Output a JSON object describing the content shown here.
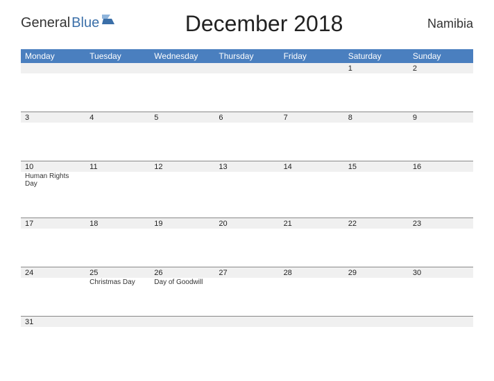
{
  "header": {
    "logo_general": "General",
    "logo_blue": "Blue",
    "title": "December 2018",
    "region": "Namibia"
  },
  "days": [
    "Monday",
    "Tuesday",
    "Wednesday",
    "Thursday",
    "Friday",
    "Saturday",
    "Sunday"
  ],
  "weeks": [
    {
      "cells": [
        {
          "num": "",
          "event": ""
        },
        {
          "num": "",
          "event": ""
        },
        {
          "num": "",
          "event": ""
        },
        {
          "num": "",
          "event": ""
        },
        {
          "num": "",
          "event": ""
        },
        {
          "num": "1",
          "event": ""
        },
        {
          "num": "2",
          "event": ""
        }
      ]
    },
    {
      "cells": [
        {
          "num": "3",
          "event": ""
        },
        {
          "num": "4",
          "event": ""
        },
        {
          "num": "5",
          "event": ""
        },
        {
          "num": "6",
          "event": ""
        },
        {
          "num": "7",
          "event": ""
        },
        {
          "num": "8",
          "event": ""
        },
        {
          "num": "9",
          "event": ""
        }
      ]
    },
    {
      "cells": [
        {
          "num": "10",
          "event": "Human Rights Day"
        },
        {
          "num": "11",
          "event": ""
        },
        {
          "num": "12",
          "event": ""
        },
        {
          "num": "13",
          "event": ""
        },
        {
          "num": "14",
          "event": ""
        },
        {
          "num": "15",
          "event": ""
        },
        {
          "num": "16",
          "event": ""
        }
      ]
    },
    {
      "cells": [
        {
          "num": "17",
          "event": ""
        },
        {
          "num": "18",
          "event": ""
        },
        {
          "num": "19",
          "event": ""
        },
        {
          "num": "20",
          "event": ""
        },
        {
          "num": "21",
          "event": ""
        },
        {
          "num": "22",
          "event": ""
        },
        {
          "num": "23",
          "event": ""
        }
      ]
    },
    {
      "cells": [
        {
          "num": "24",
          "event": ""
        },
        {
          "num": "25",
          "event": "Christmas Day"
        },
        {
          "num": "26",
          "event": "Day of Goodwill"
        },
        {
          "num": "27",
          "event": ""
        },
        {
          "num": "28",
          "event": ""
        },
        {
          "num": "29",
          "event": ""
        },
        {
          "num": "30",
          "event": ""
        }
      ]
    },
    {
      "cells": [
        {
          "num": "31",
          "event": ""
        },
        {
          "num": "",
          "event": ""
        },
        {
          "num": "",
          "event": ""
        },
        {
          "num": "",
          "event": ""
        },
        {
          "num": "",
          "event": ""
        },
        {
          "num": "",
          "event": ""
        },
        {
          "num": "",
          "event": ""
        }
      ]
    }
  ]
}
